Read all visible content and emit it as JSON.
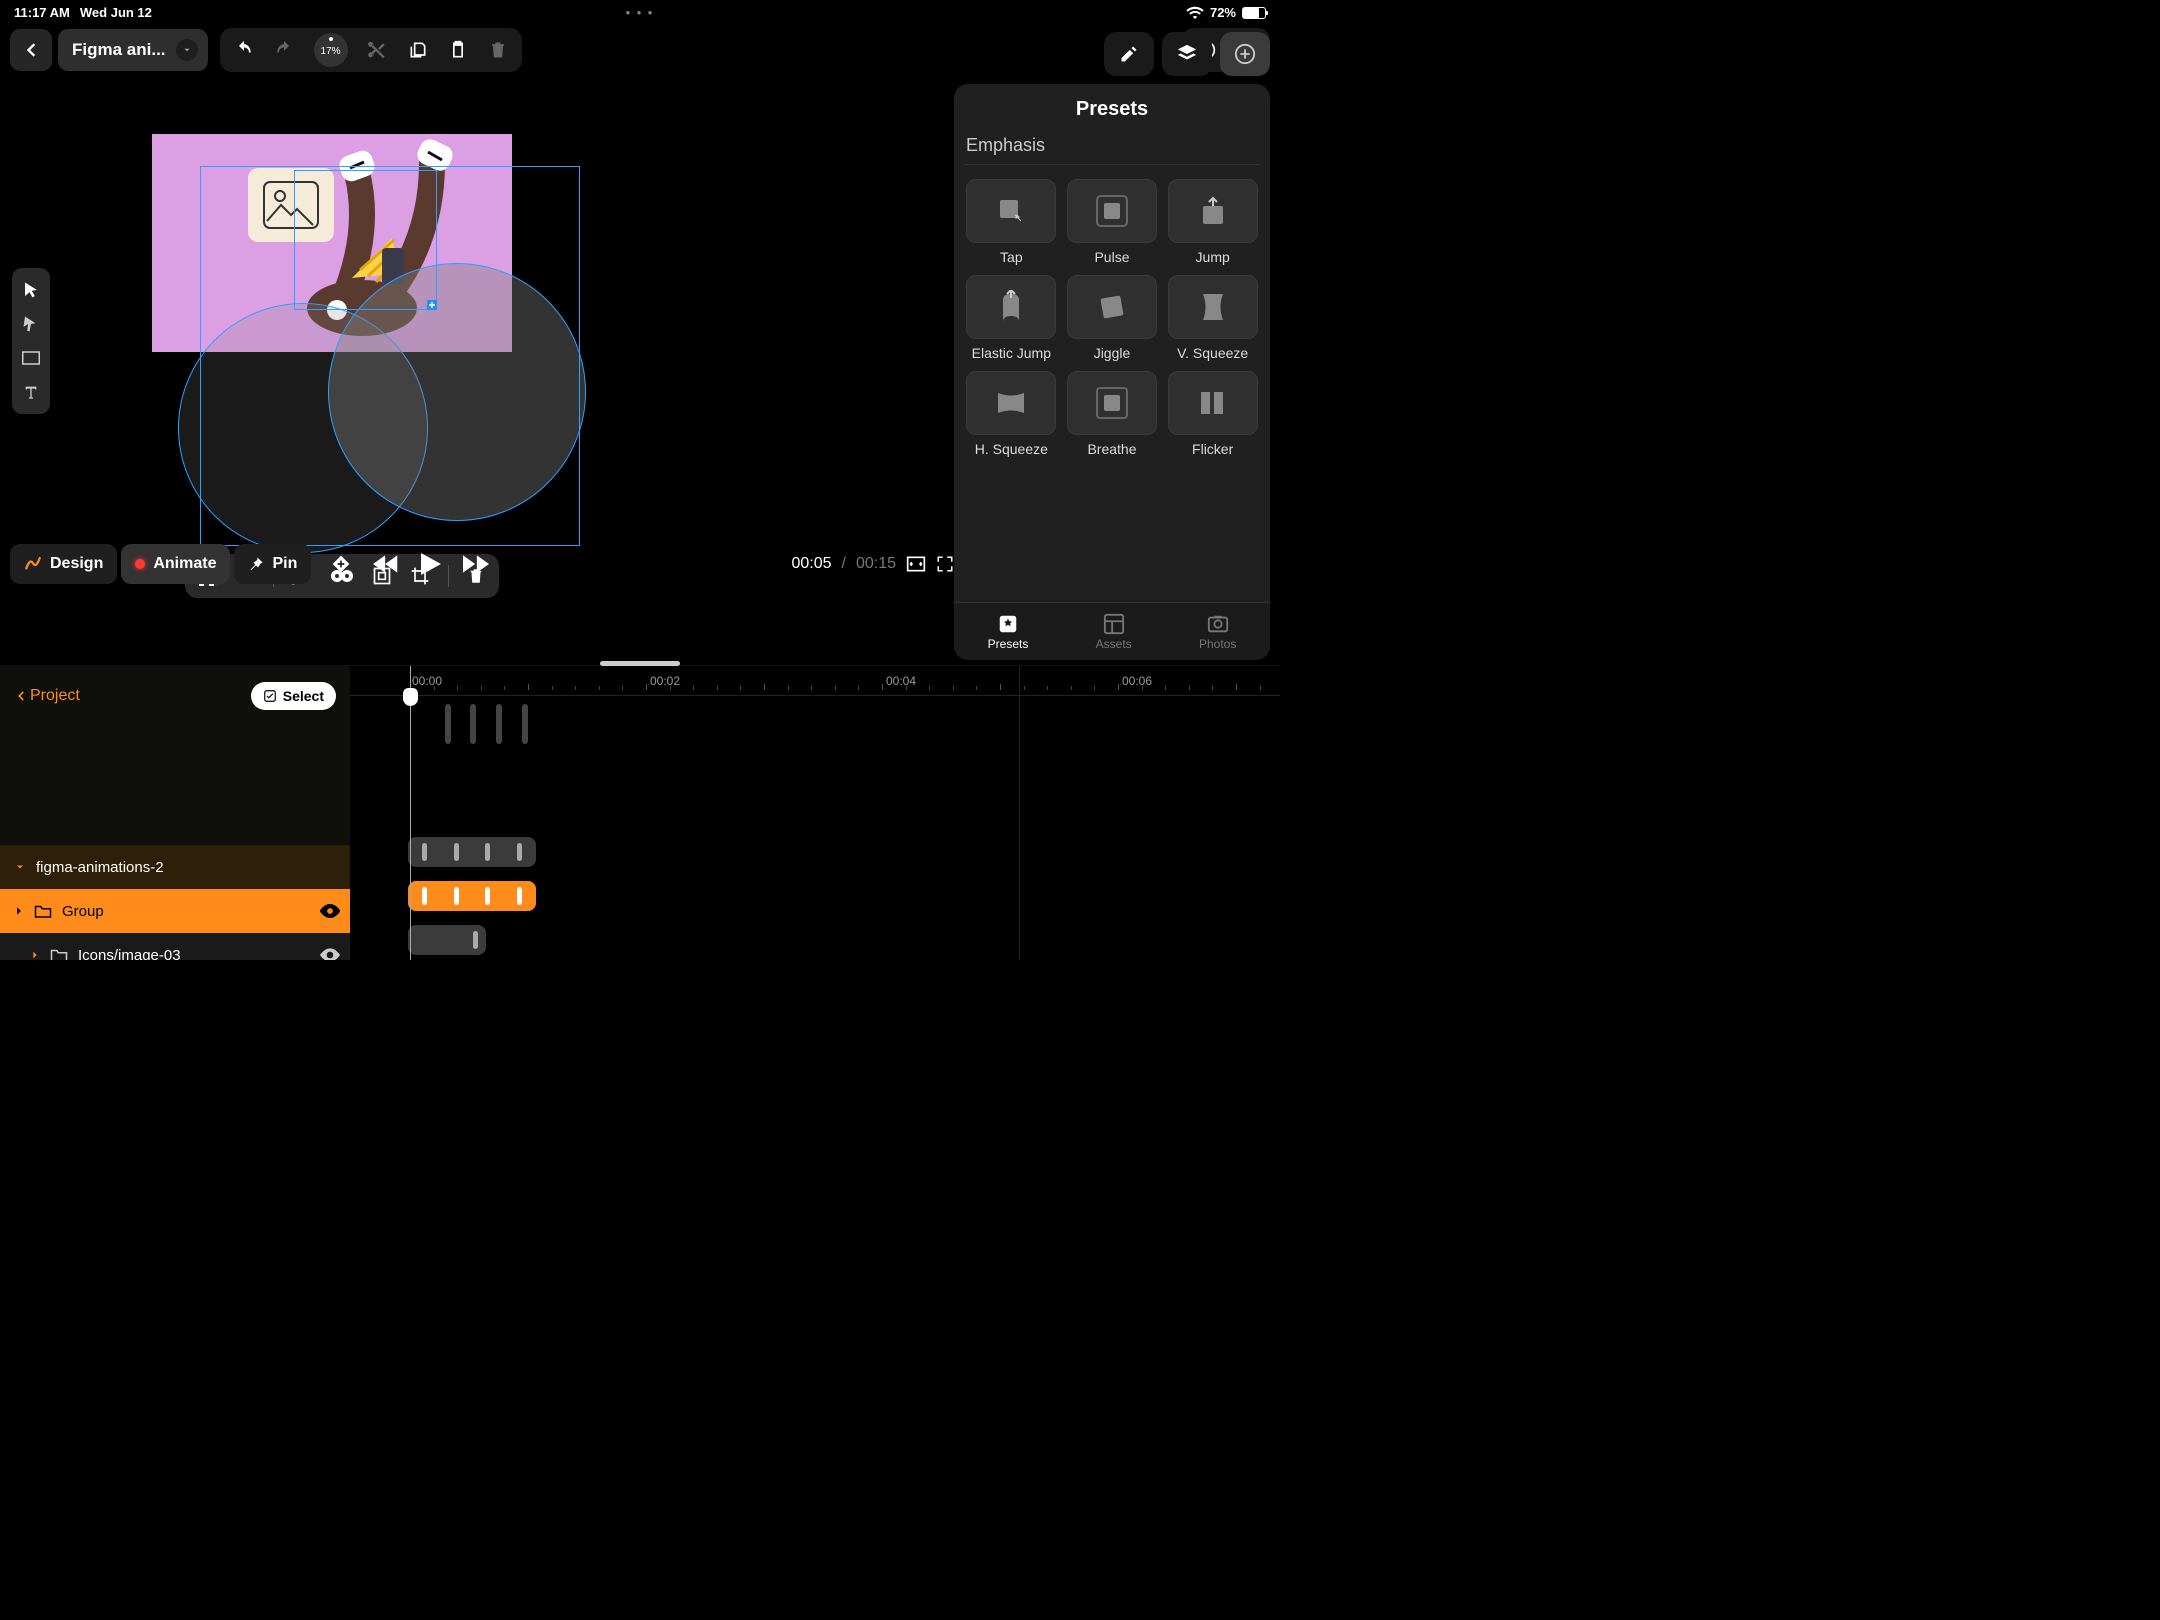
{
  "status": {
    "time": "11:17 AM",
    "date": "Wed Jun 12",
    "battery_pct": "72%"
  },
  "topbar": {
    "title": "Figma ani...",
    "zoom": "17%"
  },
  "playbar": {
    "design": "Design",
    "animate": "Animate",
    "pin": "Pin",
    "time_current": "00:05",
    "time_total": "00:15"
  },
  "panel": {
    "title": "Presets",
    "section": "Emphasis",
    "presets": [
      "Tap",
      "Pulse",
      "Jump",
      "Elastic Jump",
      "Jiggle",
      "V. Squeeze",
      "H. Squeeze",
      "Breathe",
      "Flicker"
    ],
    "tabs": {
      "presets": "Presets",
      "assets": "Assets",
      "photos": "Photos"
    }
  },
  "layers": {
    "back": "Project",
    "select": "Select",
    "root": "figma-animations-2",
    "items": [
      {
        "name": "Group",
        "selected": true
      },
      {
        "name": "Icons/image-03",
        "selected": false
      }
    ]
  },
  "ruler": {
    "t0": "00:00",
    "t2": "00:02",
    "t4": "00:04",
    "t6": "00:06"
  }
}
